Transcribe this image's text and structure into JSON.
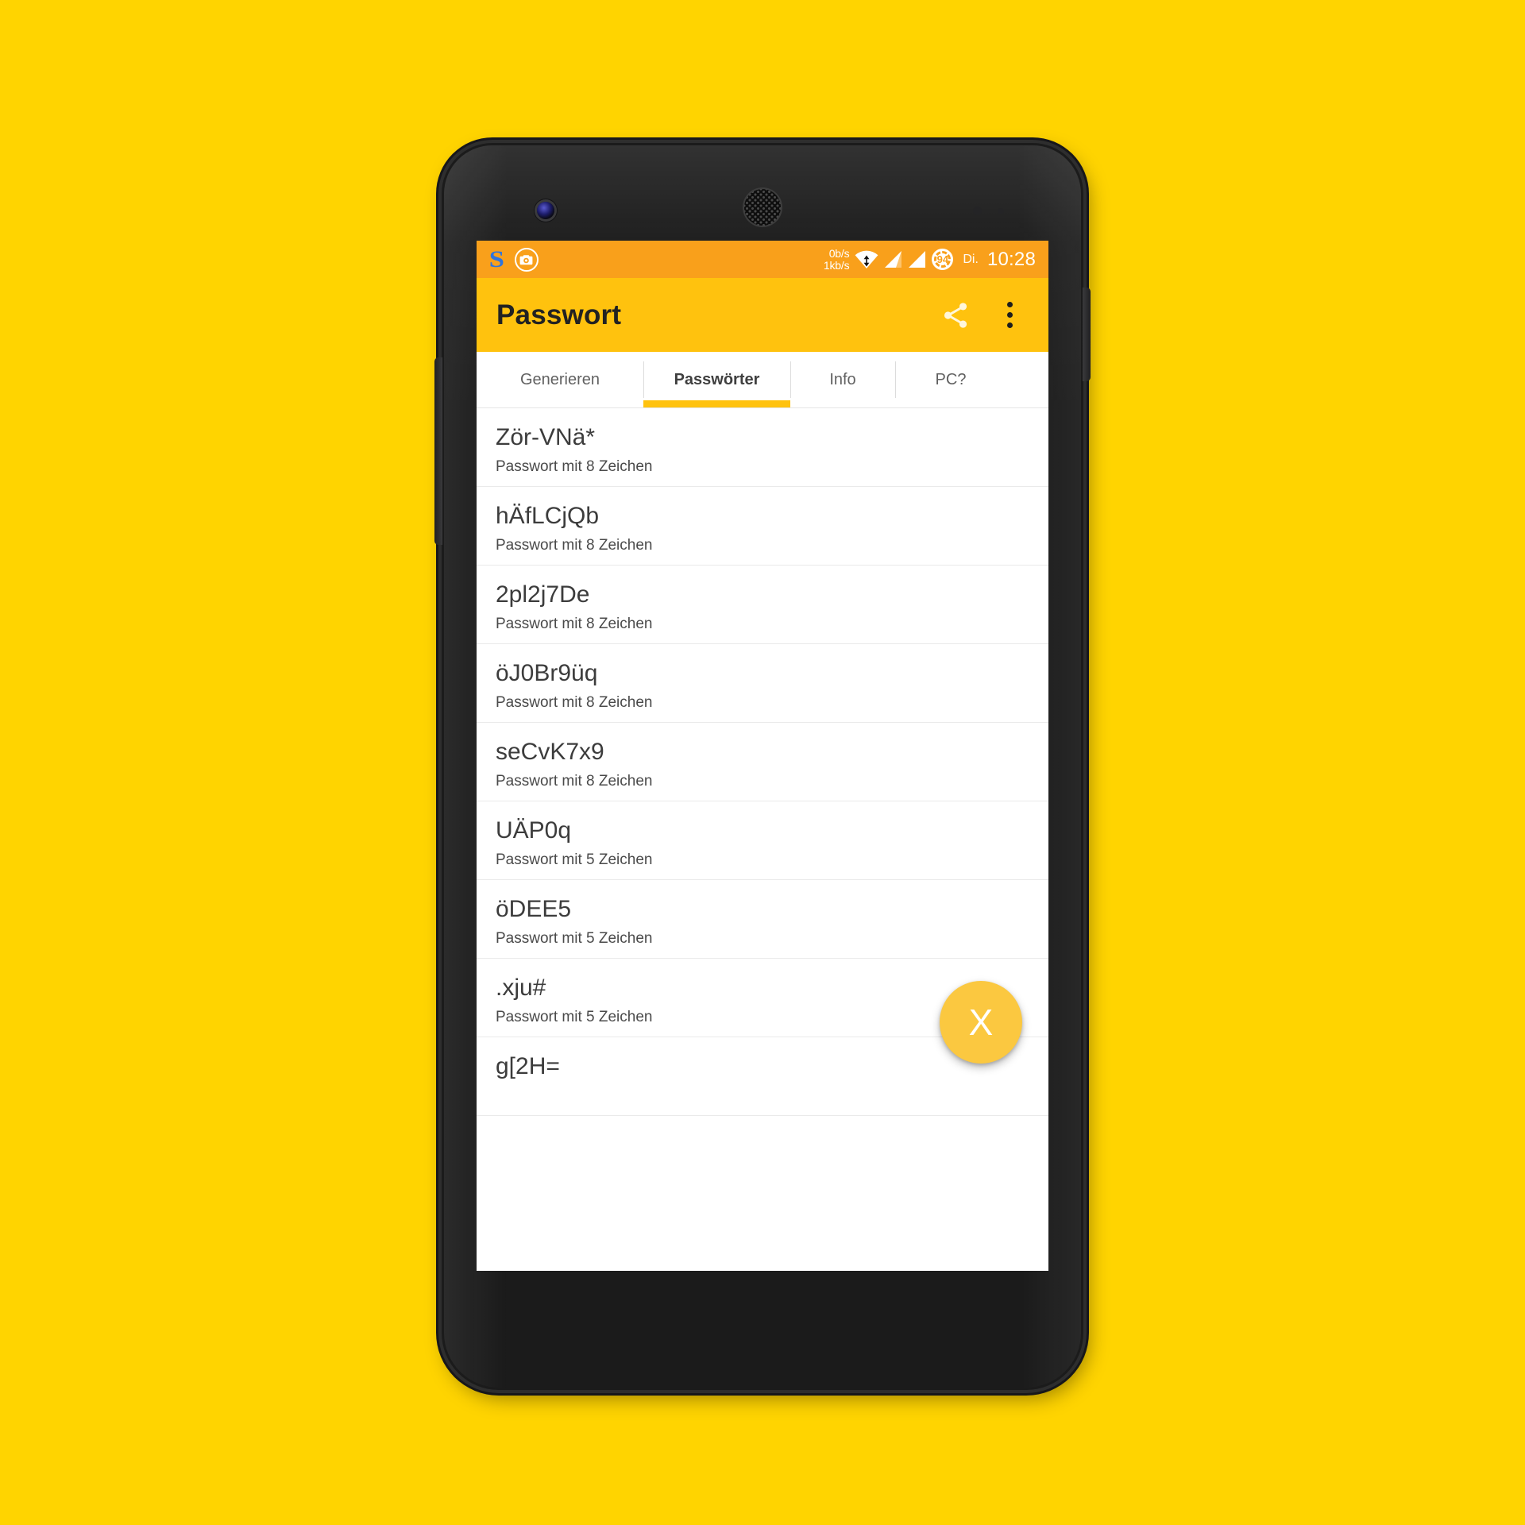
{
  "background_color": "#FFD400",
  "device": {
    "name": "android-phone",
    "body_color": "#1b1b1b",
    "hardware": {
      "front_camera": "front-camera",
      "earpiece": "earpiece-speaker",
      "power_button": "power-button",
      "volume_button": "volume-button"
    }
  },
  "status_bar": {
    "background": "#F9A01B",
    "left_icons": [
      {
        "name": "s-logo-icon",
        "glyph": "S",
        "color": "#2E74DE"
      },
      {
        "name": "camera-badge-icon",
        "glyph": "camera"
      }
    ],
    "net_speed_down": "0b/s",
    "net_speed_up": "1kb/s",
    "wifi_icon": "wifi-icon",
    "signal_icon_1": "signal-bars-icon",
    "signal_icon_2": "signal-bars-icon",
    "battery_level": "94",
    "day": "Di.",
    "time": "10:28"
  },
  "app_bar": {
    "background": "#FFC20E",
    "title": "Passwort",
    "share_label": "share-icon",
    "overflow_label": "overflow-menu-icon"
  },
  "tabs": {
    "active_index": 1,
    "indicator_color": "#FFC20E",
    "items": [
      {
        "label": "Generieren"
      },
      {
        "label": "Passwörter"
      },
      {
        "label": "Info"
      },
      {
        "label": "PC?"
      }
    ]
  },
  "password_list": {
    "items": [
      {
        "value": "Zör-VNä*",
        "meta": "Passwort mit 8 Zeichen"
      },
      {
        "value": "hÄfLCjQb",
        "meta": "Passwort mit 8 Zeichen"
      },
      {
        "value": "2pl2j7De",
        "meta": "Passwort mit 8 Zeichen"
      },
      {
        "value": "öJ0Br9üq",
        "meta": "Passwort mit 8 Zeichen"
      },
      {
        "value": "seCvK7x9",
        "meta": "Passwort mit 8 Zeichen"
      },
      {
        "value": "UÄP0q",
        "meta": "Passwort mit 5 Zeichen"
      },
      {
        "value": "öDEE5",
        "meta": "Passwort mit 5 Zeichen"
      },
      {
        "value": ".xju#",
        "meta": "Passwort mit 5 Zeichen"
      },
      {
        "value": "g[2H=",
        "meta": ""
      }
    ]
  },
  "fab": {
    "label": "X",
    "color": "#FBC840"
  }
}
